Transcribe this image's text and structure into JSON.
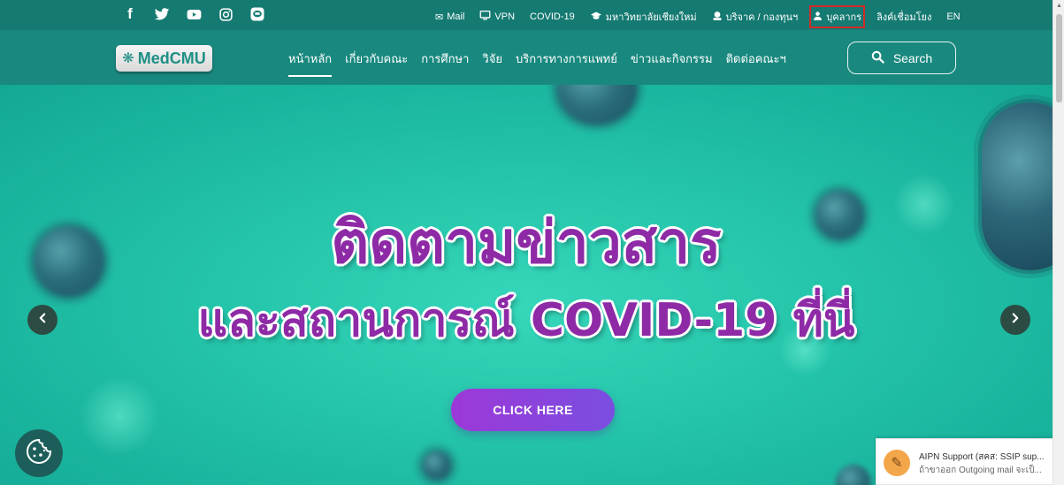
{
  "topbar": {
    "social": [
      {
        "name": "facebook-icon",
        "glyph": "f"
      },
      {
        "name": "twitter-icon",
        "glyph": "twitter"
      },
      {
        "name": "youtube-icon",
        "glyph": "youtube"
      },
      {
        "name": "instagram-icon",
        "glyph": "instagram"
      },
      {
        "name": "line-icon",
        "glyph": "line"
      }
    ],
    "links": {
      "mail": "Mail",
      "vpn": "VPN",
      "covid": "COVID-19",
      "university": "มหาวิทยาลัยเชียงใหม่",
      "donate": "บริจาค / กองทุนฯ",
      "personnel": "บุคลากร",
      "related_links": "ลิงค์เชื่อมโยง",
      "lang": "EN"
    },
    "highlight_color": "#d42a2a"
  },
  "nav": {
    "logo_text": "MedCMU",
    "items": [
      "หน้าหลัก",
      "เกี่ยวกับคณะ",
      "การศึกษา",
      "วิจัย",
      "บริการทางการแพทย์",
      "ข่าวและกิจกรรม",
      "ติดต่อคณะฯ"
    ],
    "active_index": 0,
    "search_label": "Search"
  },
  "hero": {
    "line1": "ติดตามข่าวสาร",
    "line2": "และสถานการณ์ COVID-19 ที่นี่",
    "cta": "CLICK HERE",
    "prev_icon": "chevron-left-icon",
    "next_icon": "chevron-right-icon"
  },
  "toast": {
    "title": "AIPN Support (สคส: SSIP sup...",
    "message": "ถ้าขาออก Outgoing mail จะเป็...",
    "close": "✕"
  },
  "colors": {
    "topbar": "#157a72",
    "navbar": "#19897f",
    "headline": "#8e2aa6",
    "cta_start": "#9d38d8",
    "cta_end": "#7a4ee0"
  }
}
